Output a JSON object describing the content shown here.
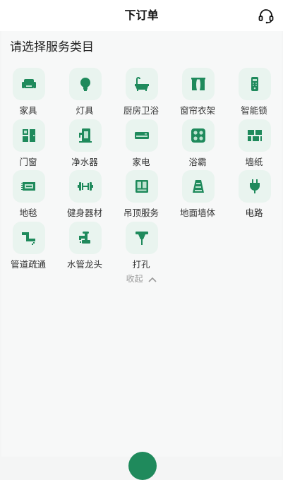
{
  "header": {
    "title": "下订单",
    "support_icon": "headset-icon"
  },
  "section": {
    "title": "请选择服务类目"
  },
  "accent_color": "#1f8a5c",
  "categories": [
    {
      "label": "家具",
      "icon": "sofa-icon"
    },
    {
      "label": "灯具",
      "icon": "bulb-icon"
    },
    {
      "label": "厨房卫浴",
      "icon": "bathtub-icon"
    },
    {
      "label": "窗帘衣架",
      "icon": "curtain-icon"
    },
    {
      "label": "智能锁",
      "icon": "smart-lock-icon"
    },
    {
      "label": "门窗",
      "icon": "door-window-icon"
    },
    {
      "label": "净水器",
      "icon": "water-purifier-icon"
    },
    {
      "label": "家电",
      "icon": "air-conditioner-icon"
    },
    {
      "label": "浴霸",
      "icon": "bath-heater-icon"
    },
    {
      "label": "墙纸",
      "icon": "wallpaper-icon"
    },
    {
      "label": "地毯",
      "icon": "carpet-icon"
    },
    {
      "label": "健身器材",
      "icon": "dumbbell-icon"
    },
    {
      "label": "吊顶服务",
      "icon": "ceiling-icon"
    },
    {
      "label": "地面墙体",
      "icon": "floor-wall-icon"
    },
    {
      "label": "电路",
      "icon": "plug-icon"
    },
    {
      "label": "管道疏通",
      "icon": "pipe-icon"
    },
    {
      "label": "水管龙头",
      "icon": "faucet-icon"
    },
    {
      "label": "打孔",
      "icon": "drill-icon"
    }
  ],
  "collapse": {
    "label": "收起"
  }
}
